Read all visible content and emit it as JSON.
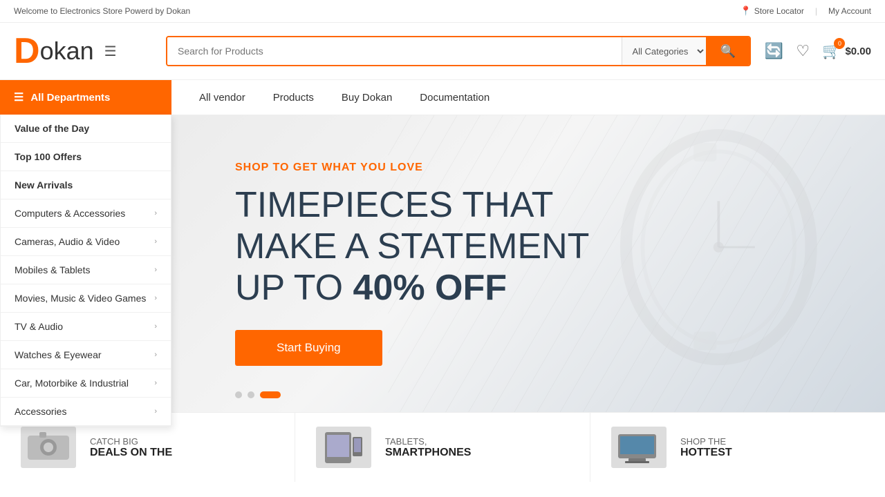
{
  "topbar": {
    "welcome_text": "Welcome to Electronics Store Powerd by Dokan",
    "store_locator": "Store Locator",
    "my_account": "My Account"
  },
  "header": {
    "logo_d": "D",
    "logo_text": "okan",
    "search_placeholder": "Search for Products",
    "search_category_label": "All Categories",
    "cart_badge": "0",
    "cart_price": "$0.00"
  },
  "nav": {
    "all_departments": "All Departments",
    "links": [
      {
        "label": "All vendor"
      },
      {
        "label": "Products"
      },
      {
        "label": "Buy Dokan"
      },
      {
        "label": "Documentation"
      }
    ]
  },
  "sidebar": {
    "items": [
      {
        "label": "Value of the Day",
        "bold": true,
        "has_arrow": false
      },
      {
        "label": "Top 100 Offers",
        "bold": true,
        "has_arrow": false
      },
      {
        "label": "New Arrivals",
        "bold": true,
        "has_arrow": false
      },
      {
        "label": "Computers & Accessories",
        "bold": false,
        "has_arrow": true
      },
      {
        "label": "Cameras, Audio & Video",
        "bold": false,
        "has_arrow": true
      },
      {
        "label": "Mobiles & Tablets",
        "bold": false,
        "has_arrow": true
      },
      {
        "label": "Movies, Music & Video Games",
        "bold": false,
        "has_arrow": true
      },
      {
        "label": "TV & Audio",
        "bold": false,
        "has_arrow": true
      },
      {
        "label": "Watches & Eyewear",
        "bold": false,
        "has_arrow": true
      },
      {
        "label": "Car, Motorbike & Industrial",
        "bold": false,
        "has_arrow": true
      },
      {
        "label": "Accessories",
        "bold": false,
        "has_arrow": true
      }
    ]
  },
  "hero": {
    "subtitle": "SHOP TO GET WHAT YOU LOVE",
    "line1": "TIMEPIECES THAT",
    "line2": "MAKE A STATEMENT",
    "line3_prefix": "UP TO ",
    "line3_bold": "40% OFF",
    "button_label": "Start Buying",
    "slide_count": 3,
    "active_slide": 2
  },
  "promo": {
    "items": [
      {
        "label_prefix": "CATCH BIG",
        "label_bold": "",
        "desc": "DEALS ON THE"
      },
      {
        "label_prefix": "TABLETS,",
        "label_bold": "",
        "desc": "SMARTPHONES"
      },
      {
        "label_prefix": "SHOP THE",
        "label_bold": "",
        "desc": "HOTTEST"
      }
    ]
  }
}
